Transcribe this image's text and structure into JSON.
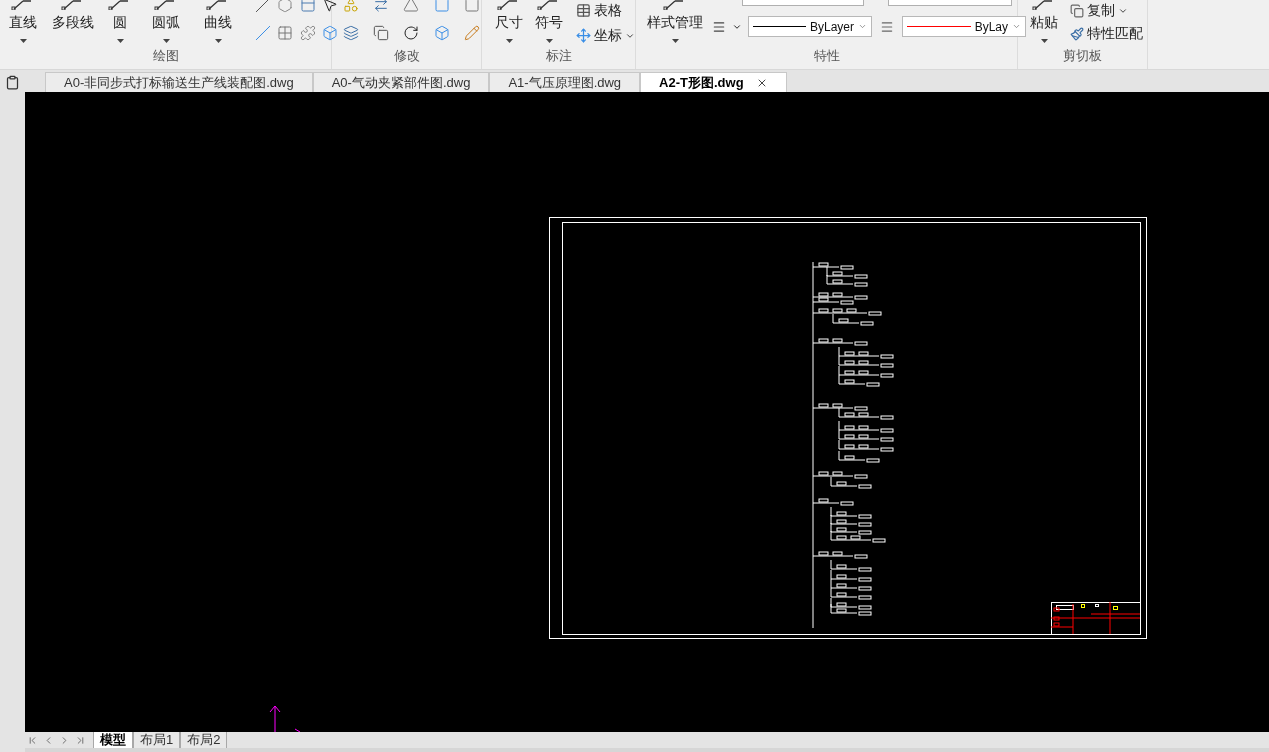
{
  "ribbon": {
    "panels": [
      {
        "title": "绘图",
        "large_buttons": [
          {
            "label": "直线",
            "dropdown": true
          },
          {
            "label": "多段线",
            "dropdown": false
          },
          {
            "label": "圆",
            "dropdown": true
          },
          {
            "label": "圆弧",
            "dropdown": true
          },
          {
            "label": "曲线",
            "dropdown": true
          }
        ]
      },
      {
        "title": "修改"
      },
      {
        "title": "标注",
        "large_buttons": [
          {
            "label": "尺寸",
            "dropdown": true
          },
          {
            "label": "符号",
            "dropdown": true
          }
        ],
        "small_buttons": [
          {
            "label": "表格",
            "dropdown": false
          },
          {
            "label": "坐标",
            "dropdown": true
          }
        ]
      },
      {
        "title": "特性",
        "large_buttons": [
          {
            "label": "样式管理",
            "dropdown": true
          }
        ],
        "dropdowns": [
          {
            "value": "ByLayer",
            "color": "#000000"
          },
          {
            "value": "ByLay",
            "color": "#ff0000"
          }
        ]
      },
      {
        "title": "剪切板",
        "large_buttons": [
          {
            "label": "粘贴",
            "dropdown": true
          }
        ],
        "small_buttons": [
          {
            "label": "复制",
            "dropdown": true
          },
          {
            "label": "特性匹配",
            "dropdown": false
          }
        ]
      }
    ]
  },
  "document_tabs": [
    {
      "label": "A0-非同步式打标输送生产线装配图.dwg",
      "selected": false
    },
    {
      "label": "A0-气动夹紧部件图.dwg",
      "selected": false
    },
    {
      "label": "A1-气压原理图.dwg",
      "selected": false
    },
    {
      "label": "A2-T形图.dwg",
      "selected": true
    }
  ],
  "layout_tabs": [
    {
      "label": "模型",
      "selected": true
    },
    {
      "label": "布局1",
      "selected": false
    },
    {
      "label": "布局2",
      "selected": false
    }
  ]
}
